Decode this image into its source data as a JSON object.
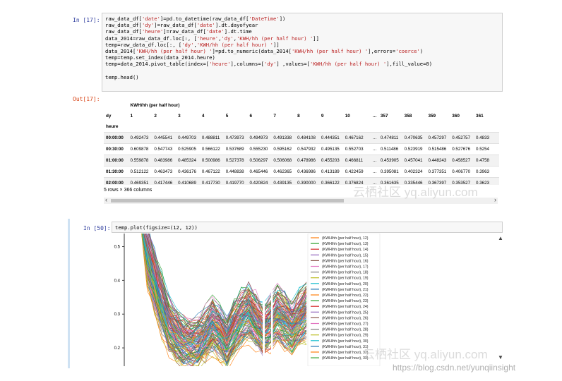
{
  "cell1": {
    "prompt_in": "In [17]:",
    "prompt_out": "Out[17]:",
    "code_lines": [
      "raw_data_df['date']=pd.to_datetime(raw_data_df['DateTime'])",
      "raw_data_df['dy']=raw_data_df['date'].dt.dayofyear",
      "raw_data_df['heure']=raw_data_df['date'].dt.time",
      "data_2014=raw_data_df.loc[:, ['heure','dy','KWH/hh (per half hour) ']]",
      "temp=raw_data_df.loc[:, ['dy','KWH/hh (per half hour) ']]",
      "data_2014['KWH/hh (per half hour) ']=pd.to_numeric(data_2014['KWH/hh (per half hour) '],errors='coerce')",
      "temp=temp.set_index(data_2014.heure)",
      "temp=data_2014.pivot_table(index=['heure'],columns=['dy'] ,values=['KWH/hh (per half hour) '],fill_value=0)",
      "",
      "temp.head()"
    ],
    "dataframe": {
      "top_header": "KWH/hh (per half hour)",
      "columns_label": "dy",
      "index_label": "heure",
      "columns": [
        "1",
        "2",
        "3",
        "4",
        "5",
        "6",
        "7",
        "8",
        "9",
        "10",
        "...",
        "357",
        "358",
        "359",
        "360",
        "361"
      ],
      "rows": [
        {
          "index": "00:00:00",
          "values": [
            "0.492473",
            "0.445541",
            "0.449703",
            "0.488811",
            "0.473973",
            "0.494973",
            "0.491338",
            "0.484108",
            "0.444351",
            "0.467162",
            "...",
            "0.474811",
            "0.470635",
            "0.457297",
            "0.452757",
            "0.4833"
          ]
        },
        {
          "index": "00:30:00",
          "values": [
            "0.609878",
            "0.547743",
            "0.525905",
            "0.566122",
            "0.537689",
            "0.555230",
            "0.595162",
            "0.547932",
            "0.495135",
            "0.552703",
            "...",
            "0.511486",
            "0.523919",
            "0.515486",
            "0.527676",
            "0.5254"
          ]
        },
        {
          "index": "01:00:00",
          "values": [
            "0.559878",
            "0.483986",
            "0.485324",
            "0.500986",
            "0.527378",
            "0.506297",
            "0.506068",
            "0.478986",
            "0.455203",
            "0.466811",
            "...",
            "0.453905",
            "0.457041",
            "0.448243",
            "0.458527",
            "0.4758"
          ]
        },
        {
          "index": "01:30:00",
          "values": [
            "0.512122",
            "0.463473",
            "0.436176",
            "0.467122",
            "0.448838",
            "0.465446",
            "0.462365",
            "0.436986",
            "0.413189",
            "0.422459",
            "...",
            "0.395081",
            "0.402324",
            "0.377351",
            "0.406770",
            "0.3963"
          ]
        },
        {
          "index": "02:00:00",
          "values": [
            "0.469351",
            "0.417446",
            "0.410689",
            "0.417730",
            "0.419770",
            "0.420824",
            "0.439135",
            "0.390000",
            "0.366122",
            "0.376824",
            "...",
            "0.361635",
            "0.335446",
            "0.367397",
            "0.353527",
            "0.3623"
          ]
        }
      ],
      "shape_note": "5 rows × 366 columns"
    }
  },
  "cell2": {
    "prompt_in": "In [50]:",
    "code": "temp.plot(figsize=(12, 12))"
  },
  "chart_data": {
    "type": "line",
    "title": "",
    "xlabel": "",
    "ylabel": "",
    "yticks": [
      "0.5",
      "0.4",
      "0.3",
      "0.2"
    ],
    "ylim_visible": [
      0.15,
      0.53
    ],
    "visible_series_start_day": 12,
    "legend_entries": [
      {
        "label": "(KWH/hh (per half hour), 12)",
        "color": "#ff7f0e"
      },
      {
        "label": "(KWH/hh (per half hour), 13)",
        "color": "#2ca02c"
      },
      {
        "label": "(KWH/hh (per half hour), 14)",
        "color": "#d62728"
      },
      {
        "label": "(KWH/hh (per half hour), 15)",
        "color": "#9467bd"
      },
      {
        "label": "(KWH/hh (per half hour), 16)",
        "color": "#8c564b"
      },
      {
        "label": "(KWH/hh (per half hour), 17)",
        "color": "#e377c2"
      },
      {
        "label": "(KWH/hh (per half hour), 18)",
        "color": "#7f7f7f"
      },
      {
        "label": "(KWH/hh (per half hour), 19)",
        "color": "#bcbd22"
      },
      {
        "label": "(KWH/hh (per half hour), 20)",
        "color": "#17becf"
      },
      {
        "label": "(KWH/hh (per half hour), 21)",
        "color": "#1f77b4"
      },
      {
        "label": "(KWH/hh (per half hour), 22)",
        "color": "#ff7f0e"
      },
      {
        "label": "(KWH/hh (per half hour), 23)",
        "color": "#2ca02c"
      },
      {
        "label": "(KWH/hh (per half hour), 24)",
        "color": "#d62728"
      },
      {
        "label": "(KWH/hh (per half hour), 25)",
        "color": "#9467bd"
      },
      {
        "label": "(KWH/hh (per half hour), 26)",
        "color": "#8c564b"
      },
      {
        "label": "(KWH/hh (per half hour), 27)",
        "color": "#e377c2"
      },
      {
        "label": "(KWH/hh (per half hour), 28)",
        "color": "#7f7f7f"
      },
      {
        "label": "(KWH/hh (per half hour), 29)",
        "color": "#bcbd22"
      },
      {
        "label": "(KWH/hh (per half hour), 30)",
        "color": "#17becf"
      },
      {
        "label": "(KWH/hh (per half hour), 31)",
        "color": "#1f77b4"
      },
      {
        "label": "(KWH/hh (per half hour), 32)",
        "color": "#ff7f0e"
      },
      {
        "label": "(KWH/hh (per half hour), 33)",
        "color": "#2ca02c"
      }
    ],
    "profile_shape": [
      0.5,
      0.62,
      0.55,
      0.48,
      0.4,
      0.33,
      0.27,
      0.24,
      0.22,
      0.215,
      0.22,
      0.24,
      0.27,
      0.25,
      0.22,
      0.26,
      0.29,
      0.31,
      0.28,
      0.25,
      0.27,
      0.3,
      0.28,
      0.26,
      0.29,
      0.31
    ]
  },
  "watermarks": {
    "wm1": "云栖社区 yq.aliyun.com",
    "wm2": "云栖社区 yq.aliyun.com",
    "wm3": "https://blog.csdn.net/yunqiinsight"
  },
  "colors": {
    "in_prompt": "#303f9f",
    "out_prompt": "#d84315",
    "code_bg": "#f7f7f7"
  }
}
